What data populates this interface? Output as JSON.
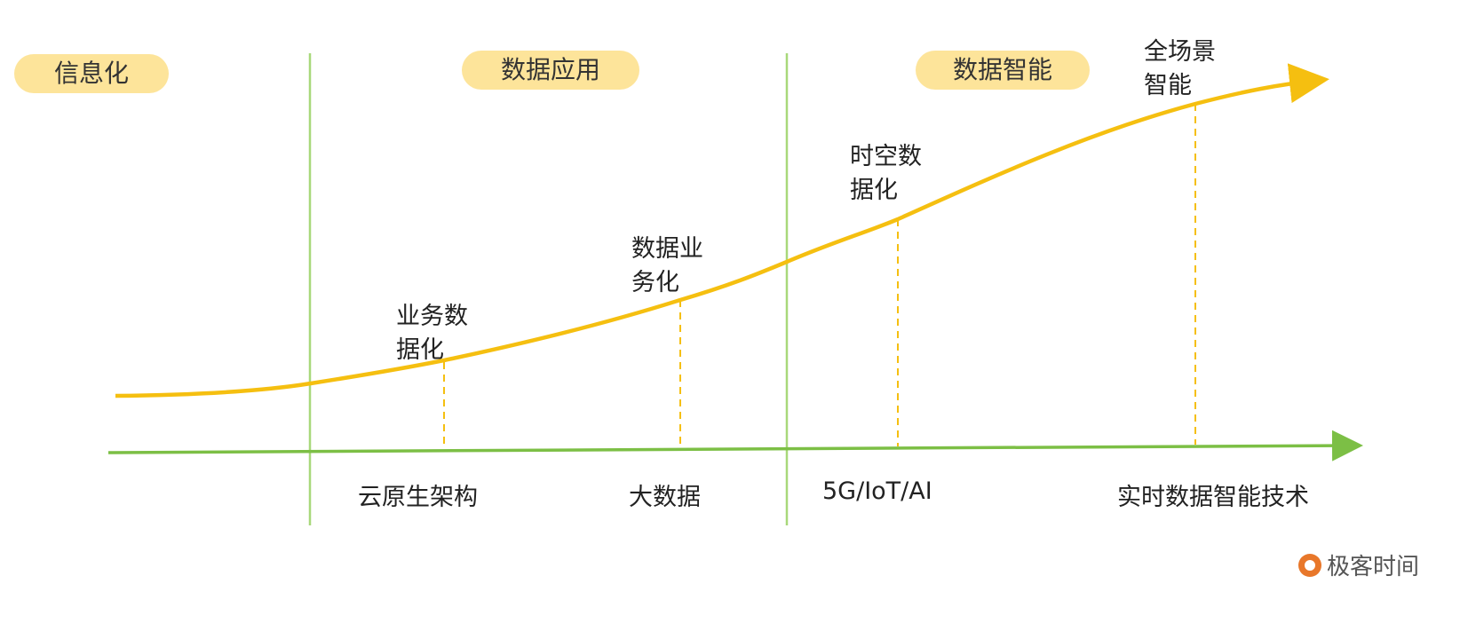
{
  "phases": [
    "信息化",
    "数据应用",
    "数据智能"
  ],
  "milestones": [
    "业务数\n据化",
    "数据业\n务化",
    "时空数\n据化",
    "全场景\n智能"
  ],
  "technologies": [
    "云原生架构",
    "大数据",
    "5G/IoT/AI",
    "实时数据智能技术"
  ],
  "logo": "极客时间",
  "colors": {
    "curve": "#f5bf10",
    "axis": "#7cbf45",
    "divider": "#a8d87a",
    "pill": "#fde49a",
    "logo": "#e8772a"
  }
}
